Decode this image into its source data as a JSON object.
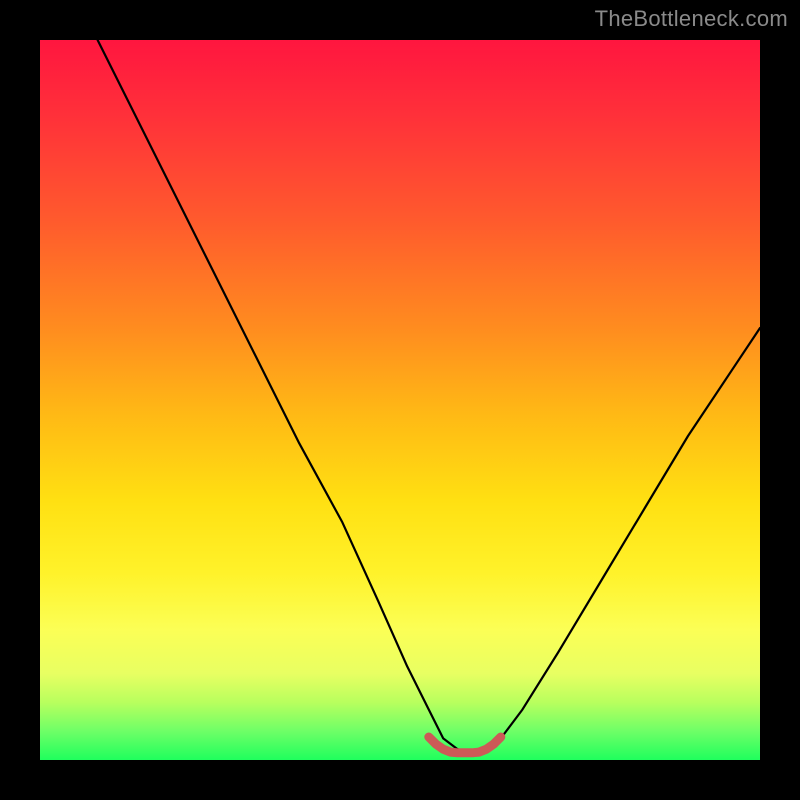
{
  "watermark": "TheBottleneck.com",
  "colors": {
    "frame": "#000000",
    "curve": "#000000",
    "highlight": "#cc5a57",
    "gradient_stops": [
      "#ff163f",
      "#ff5a2d",
      "#ffb915",
      "#fff22a",
      "#e8ff62",
      "#1fff5d"
    ]
  },
  "chart_data": {
    "type": "line",
    "title": "",
    "xlabel": "",
    "ylabel": "",
    "xlim": [
      0,
      100
    ],
    "ylim": [
      0,
      100
    ],
    "grid": false,
    "legend": false,
    "annotations": [],
    "series": [
      {
        "name": "bottleneck-curve",
        "x": [
          8,
          12,
          18,
          24,
          30,
          36,
          42,
          47,
          51,
          54,
          56,
          58,
          60,
          62,
          64,
          67,
          72,
          78,
          84,
          90,
          96,
          100
        ],
        "values": [
          100,
          92,
          80,
          68,
          56,
          44,
          33,
          22,
          13,
          7,
          3,
          1.5,
          1,
          1.5,
          3,
          7,
          15,
          25,
          35,
          45,
          54,
          60
        ]
      },
      {
        "name": "optimal-band",
        "x": [
          54,
          55,
          56,
          57,
          58,
          59,
          60,
          61,
          62,
          63,
          64
        ],
        "values": [
          3.2,
          2.2,
          1.5,
          1.1,
          1.0,
          1.0,
          1.0,
          1.1,
          1.5,
          2.2,
          3.2
        ]
      }
    ],
    "notes": "Values estimated from pixel positions; 0=bottom (green), 100=top (red). 'optimal-band' corresponds to the short pink/red segment at the valley."
  }
}
